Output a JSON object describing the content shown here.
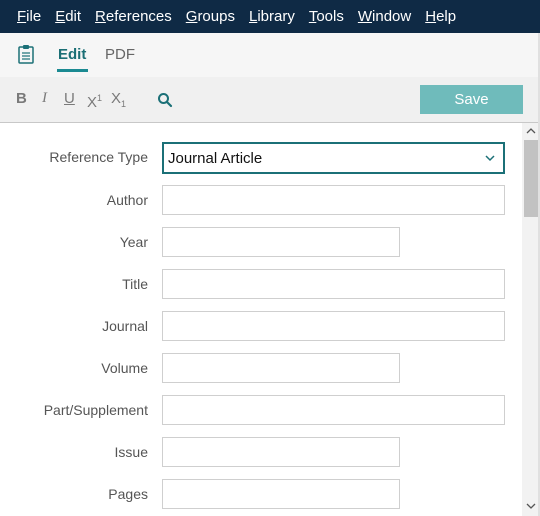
{
  "menu": [
    {
      "ul": "F",
      "rest": "ile"
    },
    {
      "ul": "E",
      "rest": "dit"
    },
    {
      "ul": "R",
      "rest": "eferences"
    },
    {
      "ul": "G",
      "rest": "roups"
    },
    {
      "ul": "L",
      "rest": "ibrary"
    },
    {
      "ul": "T",
      "rest": "ools"
    },
    {
      "ul": "W",
      "rest": "indow"
    },
    {
      "ul": "H",
      "rest": "elp"
    }
  ],
  "tabs": {
    "edit": "Edit",
    "pdf": "PDF"
  },
  "toolbar": {
    "bold": "B",
    "italic": "I",
    "underline": "U",
    "superscript": "X",
    "superscript_mark": "1",
    "subscript": "X",
    "subscript_mark": "1",
    "save_label": "Save"
  },
  "form": {
    "reference_type_label": "Reference Type",
    "reference_type_value": "Journal Article",
    "fields": [
      {
        "label": "Author",
        "value": ""
      },
      {
        "label": "Year",
        "value": ""
      },
      {
        "label": "Title",
        "value": ""
      },
      {
        "label": "Journal",
        "value": ""
      },
      {
        "label": "Volume",
        "value": ""
      },
      {
        "label": "Part/Supplement",
        "value": ""
      },
      {
        "label": "Issue",
        "value": ""
      },
      {
        "label": "Pages",
        "value": ""
      }
    ]
  },
  "colors": {
    "menubar": "#0f2a45",
    "accent": "#1b7077",
    "save_button": "#6fbbbb"
  }
}
